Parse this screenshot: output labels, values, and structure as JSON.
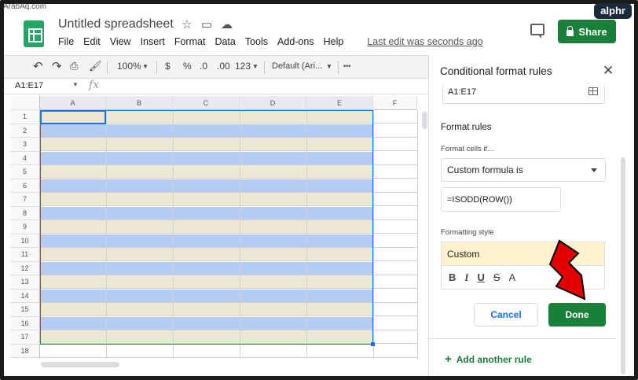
{
  "watermark": "ArabAq.com",
  "logo": "alphr",
  "header": {
    "title": "Untitled spreadsheet",
    "menu": [
      "File",
      "Edit",
      "View",
      "Insert",
      "Format",
      "Data",
      "Tools",
      "Add-ons",
      "Help"
    ],
    "last_edit": "Last edit was seconds ago",
    "share_label": "Share"
  },
  "toolbar": {
    "zoom": "100%",
    "currency": "$",
    "percent": "%",
    "dec_decrease": ".0",
    "dec_increase": ".00",
    "number_format": "123",
    "font": "Default (Ari...",
    "more": "•••"
  },
  "formula_bar": {
    "name_box": "A1:E17",
    "fx": "fx"
  },
  "grid": {
    "columns": [
      "A",
      "B",
      "C",
      "D",
      "E",
      "F"
    ],
    "rows": [
      "1",
      "2",
      "3",
      "4",
      "5",
      "6",
      "7",
      "8",
      "9",
      "10",
      "11",
      "12",
      "13",
      "14",
      "15",
      "16",
      "17",
      "18"
    ],
    "odd_color": "#ece8d4",
    "even_color": "#b4cbf2"
  },
  "panel": {
    "title": "Conditional format rules",
    "range": "A1:E17",
    "format_rules_label": "Format rules",
    "format_cells_if_label": "Format cells if…",
    "condition": "Custom formula is",
    "formula": "=ISODD(ROW())",
    "formatting_style_label": "Formatting style",
    "style_preview": "Custom",
    "style_tools": [
      "B",
      "I",
      "U",
      "S",
      "A"
    ],
    "cancel_label": "Cancel",
    "done_label": "Done",
    "add_rule_label": "Add another rule"
  },
  "colors": {
    "accent_green": "#188038",
    "accent_blue": "#1a73e8",
    "arrow_red": "#e00000"
  }
}
